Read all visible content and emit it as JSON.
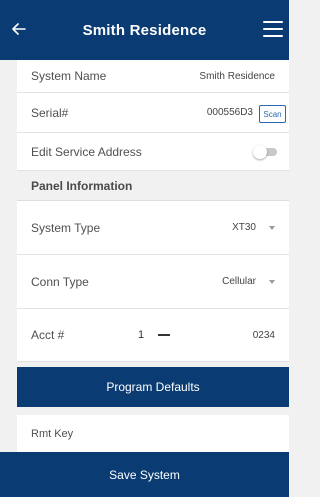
{
  "header": {
    "title": "Smith Residence",
    "back_icon": "back-arrow-icon",
    "menu_icon": "hamburger-menu-icon"
  },
  "system": {
    "name_label": "System Name",
    "name_value": "Smith Residence",
    "serial_label": "Serial#",
    "serial_value": "000556D3",
    "scan_label": "Scan",
    "address_label": "Edit Service Address",
    "address_toggle_on": false
  },
  "panel": {
    "section_title": "Panel Information",
    "system_type_label": "System Type",
    "system_type_value": "XT30",
    "conn_type_label": "Conn Type",
    "conn_type_value": "Cellular",
    "acct_label": "Acct #",
    "acct_prefix": "1",
    "acct_value": "0234"
  },
  "actions": {
    "program_defaults": "Program Defaults",
    "rmt_key_label": "Rmt Key",
    "save_system": "Save System"
  },
  "colors": {
    "brand_navy": "#0a3c73",
    "scan_blue": "#2a69b0"
  }
}
